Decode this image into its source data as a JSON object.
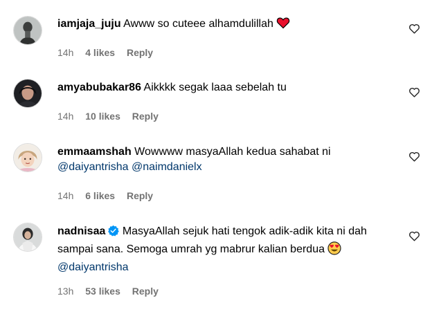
{
  "comments": [
    {
      "username": "iamjaja_juju",
      "text": "Awww so cuteee alhamdulillah",
      "time": "14h",
      "likes": "4 likes",
      "reply": "Reply",
      "avatar_icon": "avatar-photo",
      "emoji_icon": "red-heart-emoji"
    },
    {
      "username": "amyabubakar86",
      "text": "Aikkkk segak laaa sebelah tu",
      "time": "14h",
      "likes": "10 likes",
      "reply": "Reply",
      "avatar_icon": "avatar-photo"
    },
    {
      "username": "emmaamshah",
      "text": "Wowwww masyaAllah kedua sahabat ni",
      "mention1": "@daiyantrisha",
      "mention2": "@naimdanielx",
      "time": "14h",
      "likes": "6 likes",
      "reply": "Reply",
      "avatar_icon": "avatar-photo"
    },
    {
      "username": "nadnisaa",
      "verified": true,
      "text": "MasyaAllah sejuk hati tengok adik-adik kita ni dah sampai sana. Semoga umrah yg mabrur kalian berdua",
      "mention1": "@daiyantrisha",
      "time": "13h",
      "likes": "53 likes",
      "reply": "Reply",
      "avatar_icon": "avatar-photo",
      "emoji_icon": "heart-eyes-emoji"
    }
  ],
  "colors": {
    "text": "#000000",
    "secondary": "#737373",
    "mention": "#00376b",
    "verified": "#0095f6",
    "heart": "#ff3040"
  }
}
